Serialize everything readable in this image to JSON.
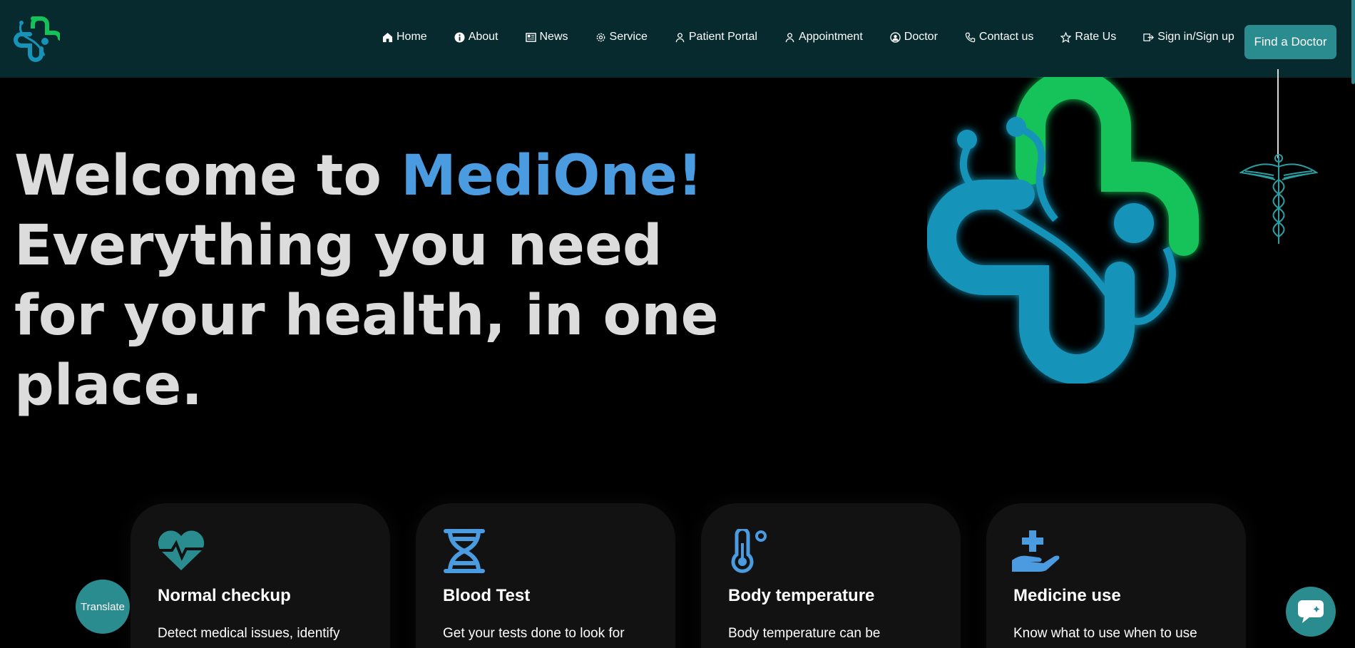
{
  "nav": {
    "items": [
      {
        "label": "Home",
        "icon": "home-icon"
      },
      {
        "label": "About",
        "icon": "info-icon"
      },
      {
        "label": "News",
        "icon": "newspaper-icon"
      },
      {
        "label": "Service",
        "icon": "gear-icon"
      },
      {
        "label": "Patient Portal",
        "icon": "user-icon"
      },
      {
        "label": "Appointment",
        "icon": "user-icon"
      },
      {
        "label": "Doctor",
        "icon": "user-circle-icon"
      },
      {
        "label": "Contact us",
        "icon": "phone-icon"
      },
      {
        "label": "Rate Us",
        "icon": "star-icon"
      },
      {
        "label": "Sign in/Sign up",
        "icon": "sign-in-icon"
      }
    ],
    "cta_label": "Find a Doctor"
  },
  "hero": {
    "welcome": "Welcome to ",
    "brand": "MediOne!",
    "tagline": "Everything you need for your health, in one place."
  },
  "cards": [
    {
      "title": "Normal checkup",
      "text": "Detect medical issues, identify",
      "icon": "heartbeat-icon"
    },
    {
      "title": "Blood Test",
      "text": "Get your tests done to look for",
      "icon": "dna-icon"
    },
    {
      "title": "Body temperature",
      "text": "Body temperature can be",
      "icon": "thermometer-icon"
    },
    {
      "title": "Medicine use",
      "text": "Know what to use when to use",
      "icon": "hand-medical-icon"
    }
  ],
  "translate_label": "Translate",
  "colors": {
    "nav_bg": "#062a2e",
    "accent": "#2a8c8f",
    "brand_blue": "#4a9be0",
    "logo_green": "#12c35a",
    "logo_blue": "#1593b8"
  }
}
